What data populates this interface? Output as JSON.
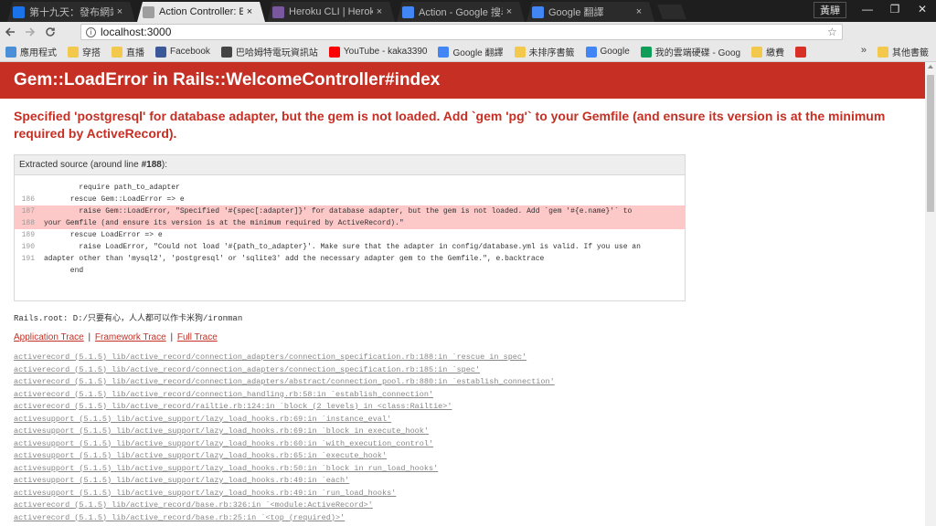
{
  "browser": {
    "tabs": [
      {
        "title": "第十九天：發布網站到 H",
        "icon": "cloud-icon",
        "color": "#1a73e8"
      },
      {
        "title": "Action Controller: Excep",
        "icon": "document-icon",
        "color": "#9e9e9e"
      },
      {
        "title": "Heroku CLI | Heroku De",
        "icon": "heroku-icon",
        "color": "#79589f"
      },
      {
        "title": "Action - Google 搜尋",
        "icon": "google-icon",
        "color": "#4285f4"
      },
      {
        "title": "Google 翻譯",
        "icon": "translate-icon",
        "color": "#4285f4"
      }
    ],
    "profile_label": "黃驊",
    "url": "localhost:3000",
    "bookmarks": [
      {
        "label": "應用程式",
        "icon": "apps-icon",
        "color": "#4a90d9"
      },
      {
        "label": "穿搭",
        "icon": "folder-icon",
        "color": "#f2c94c"
      },
      {
        "label": "直播",
        "icon": "folder-icon",
        "color": "#f2c94c"
      },
      {
        "label": "Facebook",
        "icon": "facebook-icon",
        "color": "#3b5998"
      },
      {
        "label": "巴哈姆特電玩資訊站",
        "icon": "bahamut-icon",
        "color": "#444444"
      },
      {
        "label": "YouTube - kaka3390",
        "icon": "youtube-icon",
        "color": "#ff0000"
      },
      {
        "label": "Google 翻譯",
        "icon": "translate-icon",
        "color": "#4285f4"
      },
      {
        "label": "未排序書籤",
        "icon": "folder-icon",
        "color": "#f2c94c"
      },
      {
        "label": "Google",
        "icon": "google-icon",
        "color": "#4285f4"
      },
      {
        "label": "我的雲端硬碟 - Goog",
        "icon": "drive-icon",
        "color": "#0f9d58"
      },
      {
        "label": "繳費",
        "icon": "folder-icon",
        "color": "#f2c94c"
      },
      {
        "label": "",
        "icon": "bank-icon",
        "color": "#d93025"
      }
    ],
    "other_bookmarks": "其他書籤"
  },
  "page": {
    "title": "Gem::LoadError in Rails::WelcomeController#index",
    "message": "Specified 'postgresql' for database adapter, but the gem is not loaded. Add `gem 'pg'` to your Gemfile (and ensure its version is at the minimum required by ActiveRecord).",
    "source_header_prefix": "Extracted source (around line ",
    "source_header_line": "#188",
    "source_header_suffix": "):",
    "source_lines": [
      {
        "num": "",
        "text": "        require path_to_adapter",
        "highlight": false
      },
      {
        "num": "186",
        "text": "      rescue Gem::LoadError => e",
        "highlight": false
      },
      {
        "num": "187",
        "text": "        raise Gem::LoadError, \"Specified '#{spec[:adapter]}' for database adapter, but the gem is not loaded. Add `gem '#{e.name}'` to",
        "highlight": true
      },
      {
        "num": "188",
        "text": "your Gemfile (and ensure its version is at the minimum required by ActiveRecord).\"",
        "highlight": true,
        "wrap": true
      },
      {
        "num": "189",
        "text": "      rescue LoadError => e",
        "highlight": false
      },
      {
        "num": "190",
        "text": "        raise LoadError, \"Could not load '#{path_to_adapter}'. Make sure that the adapter in config/database.yml is valid. If you use an",
        "highlight": false
      },
      {
        "num": "191",
        "text": "adapter other than 'mysql2', 'postgresql' or 'sqlite3' add the necessary adapter gem to the Gemfile.\", e.backtrace",
        "highlight": false,
        "wrap": true
      },
      {
        "num": "",
        "text": "      end",
        "highlight": false
      }
    ],
    "rails_root": "Rails.root: D:/只要有心，人人都可以作卡米狗/ironman",
    "trace_links": {
      "application": "Application Trace",
      "framework": "Framework Trace",
      "full": "Full Trace",
      "separator": "|"
    },
    "trace": [
      "activerecord (5.1.5) lib/active_record/connection_adapters/connection_specification.rb:188:in `rescue in spec'",
      "activerecord (5.1.5) lib/active_record/connection_adapters/connection_specification.rb:185:in `spec'",
      "activerecord (5.1.5) lib/active_record/connection_adapters/abstract/connection_pool.rb:880:in `establish_connection'",
      "activerecord (5.1.5) lib/active_record/connection_handling.rb:58:in `establish_connection'",
      "activerecord (5.1.5) lib/active_record/railtie.rb:124:in `block (2 levels) in <class:Railtie>'",
      "activesupport (5.1.5) lib/active_support/lazy_load_hooks.rb:69:in `instance_eval'",
      "activesupport (5.1.5) lib/active_support/lazy_load_hooks.rb:69:in `block in execute_hook'",
      "activesupport (5.1.5) lib/active_support/lazy_load_hooks.rb:60:in `with_execution_control'",
      "activesupport (5.1.5) lib/active_support/lazy_load_hooks.rb:65:in `execute_hook'",
      "activesupport (5.1.5) lib/active_support/lazy_load_hooks.rb:50:in `block in run_load_hooks'",
      "activesupport (5.1.5) lib/active_support/lazy_load_hooks.rb:49:in `each'",
      "activesupport (5.1.5) lib/active_support/lazy_load_hooks.rb:49:in `run_load_hooks'",
      "activerecord (5.1.5) lib/active_record/base.rb:326:in `<module:ActiveRecord>'",
      "activerecord (5.1.5) lib/active_record/base.rb:25:in `<top (required)>'"
    ]
  }
}
